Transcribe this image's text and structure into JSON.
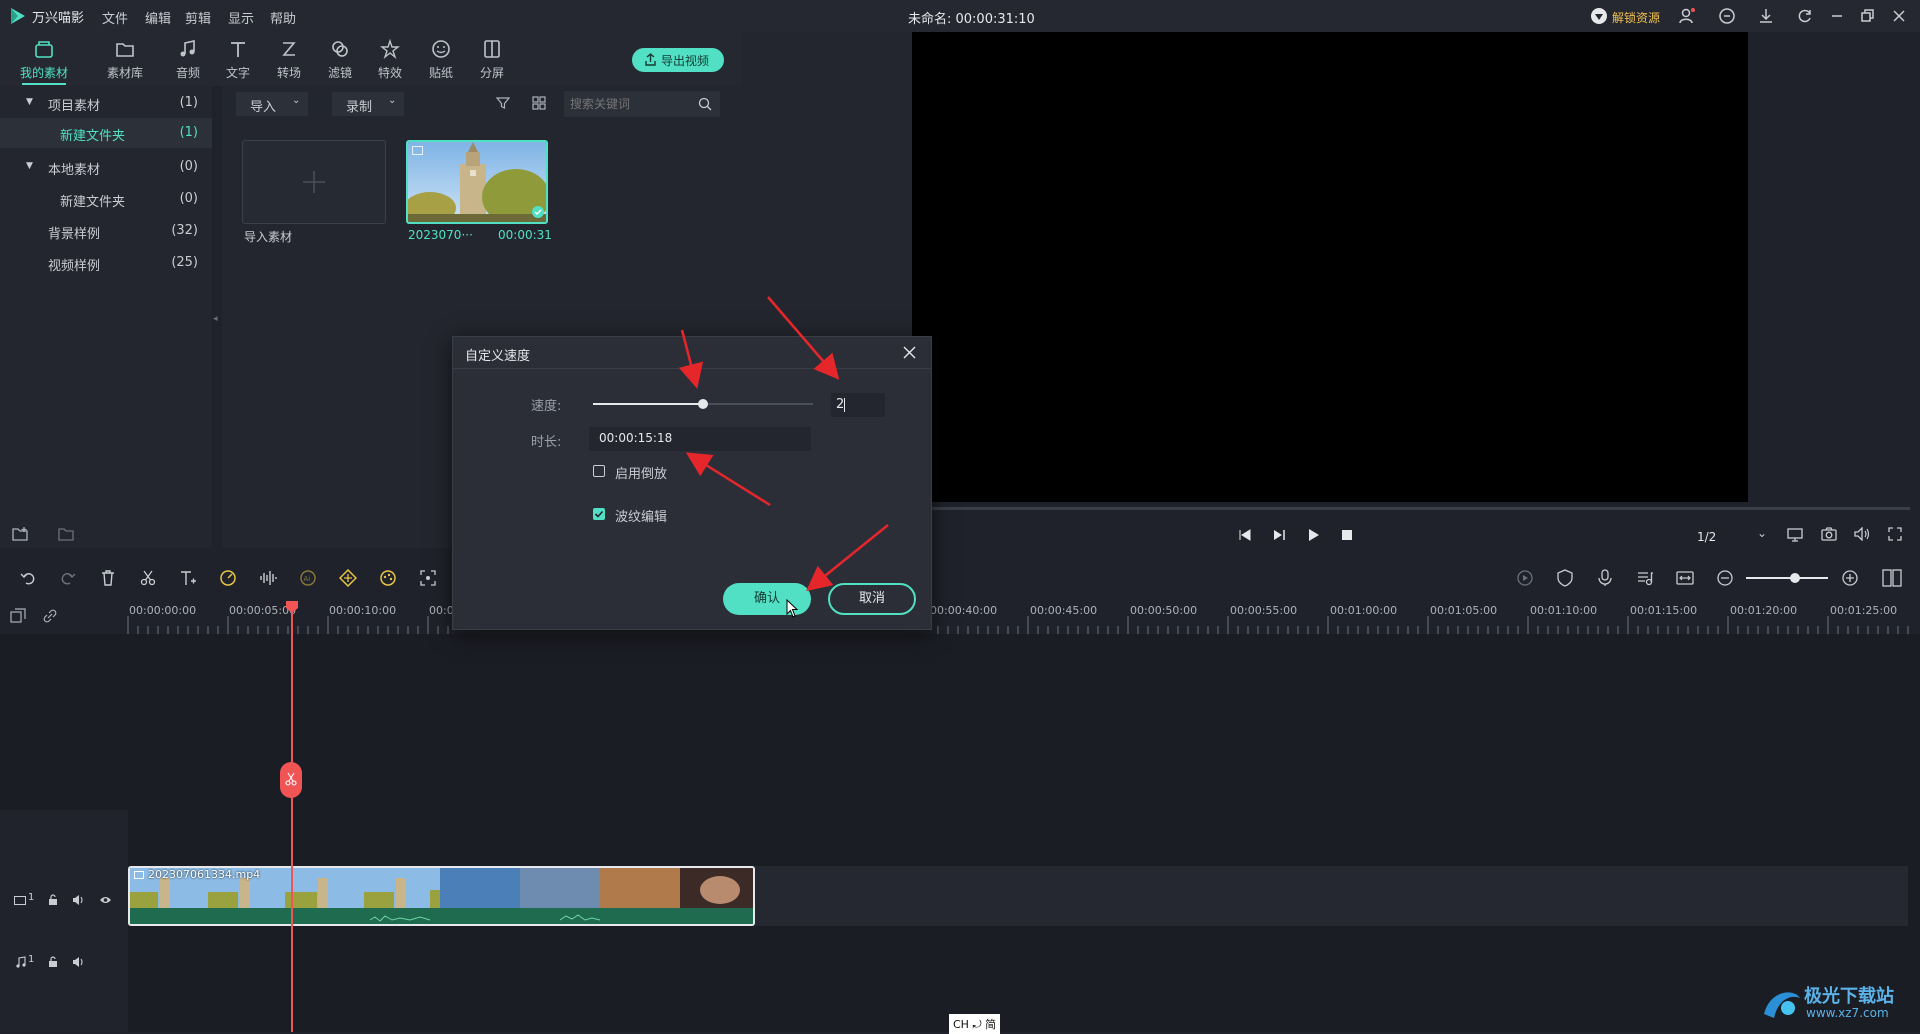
{
  "app": {
    "name": "万兴喵影",
    "doc_title": "未命名: 00:00:31:10",
    "unlock_label": "解锁资源"
  },
  "menu": [
    "文件",
    "编辑",
    "剪辑",
    "显示",
    "帮助"
  ],
  "tools": [
    {
      "label": "我的素材",
      "icon": "folder-media-icon"
    },
    {
      "label": "素材库",
      "icon": "folder-icon"
    },
    {
      "label": "音频",
      "icon": "music-note-icon"
    },
    {
      "label": "文字",
      "icon": "text-t-icon"
    },
    {
      "label": "转场",
      "icon": "transition-icon"
    },
    {
      "label": "滤镜",
      "icon": "filter-icon"
    },
    {
      "label": "特效",
      "icon": "effects-icon"
    },
    {
      "label": "贴纸",
      "icon": "sticker-icon"
    },
    {
      "label": "分屏",
      "icon": "split-screen-icon"
    }
  ],
  "export_label": "导出视频",
  "tree": [
    {
      "label": "项目素材",
      "count": "(1)",
      "expander": "▼"
    },
    {
      "label": "新建文件夹",
      "count": "(1)"
    },
    {
      "label": "本地素材",
      "count": "(0)",
      "expander": "▼"
    },
    {
      "label": "新建文件夹",
      "count": "(0)"
    },
    {
      "label": "背景样例",
      "count": "(32)"
    },
    {
      "label": "视频样例",
      "count": "(25)"
    }
  ],
  "media": {
    "import_dropdown": "导入",
    "record_dropdown": "录制",
    "search_placeholder": "搜索关键词",
    "import_tile_label": "导入素材",
    "clip_name": "2023070···",
    "clip_duration": "00:00:31"
  },
  "preview": {
    "page": "1/2",
    "progress": 0.13
  },
  "ruler_labels": [
    "00:00:00:00",
    "00:00:05:00",
    "00:00:10:00",
    "00:0",
    "00:00:40:00",
    "00:00:45:00",
    "00:00:50:00",
    "00:00:55:00",
    "00:01:00:00",
    "00:01:05:00",
    "00:01:10:00",
    "00:01:15:00",
    "00:01:20:00",
    "00:01:25:00"
  ],
  "clip": {
    "filename": "202307061334.mp4"
  },
  "tracks": {
    "video_label": "1",
    "audio_label": "1"
  },
  "dialog": {
    "title": "自定义速度",
    "speed_label": "速度:",
    "speed_value": "2",
    "speed_fraction": 0.5,
    "duration_label": "时长:",
    "duration_value": "00:00:15:18",
    "reverse_label": "启用倒放",
    "reverse_checked": false,
    "ripple_label": "波纹编辑",
    "ripple_checked": true,
    "ok_label": "确认",
    "cancel_label": "取消"
  },
  "ime": "CH ⤾ 简",
  "watermark": {
    "name": "极光下载站",
    "url": "www.xz7.com"
  },
  "colors": {
    "accent": "#51e0c4",
    "playhead": "#f05454",
    "arrow": "#e5262b"
  }
}
